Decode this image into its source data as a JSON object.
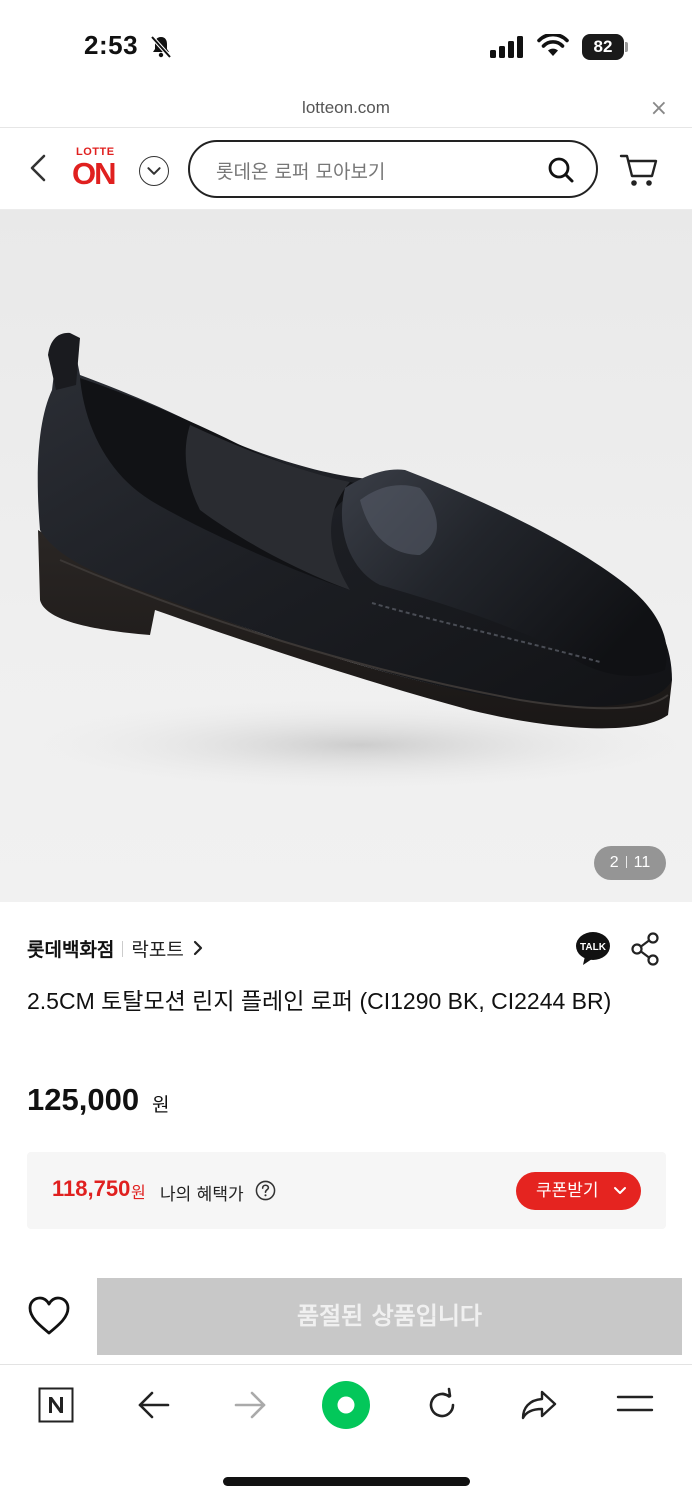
{
  "status_bar": {
    "time": "2:53",
    "battery": "82"
  },
  "url_bar": {
    "domain": "lotteon.com",
    "close": "×"
  },
  "header": {
    "logo_small": "LOTTE",
    "logo_big": "ON",
    "search_placeholder": "롯데온 로퍼 모아보기"
  },
  "gallery": {
    "current": "2",
    "total": "11"
  },
  "product": {
    "store": "롯데백화점",
    "brand": "락포트",
    "title": "2.5CM 토탈모션 린지 플레인 로퍼 (CI1290 BK, CI2244 BR)",
    "price": "125,000",
    "price_unit": "원",
    "benefit_price": "118,750",
    "benefit_unit": "원",
    "benefit_label": "나의 혜택가",
    "coupon_label": "쿠폰받기",
    "soldout_label": "품절된 상품입니다"
  },
  "icons": {
    "talk": "TALK"
  },
  "colors": {
    "brand_red": "#e0201f",
    "coupon_red": "#e52420",
    "soldout_gray": "#c8c8c8",
    "naver_green": "#03c75a"
  }
}
